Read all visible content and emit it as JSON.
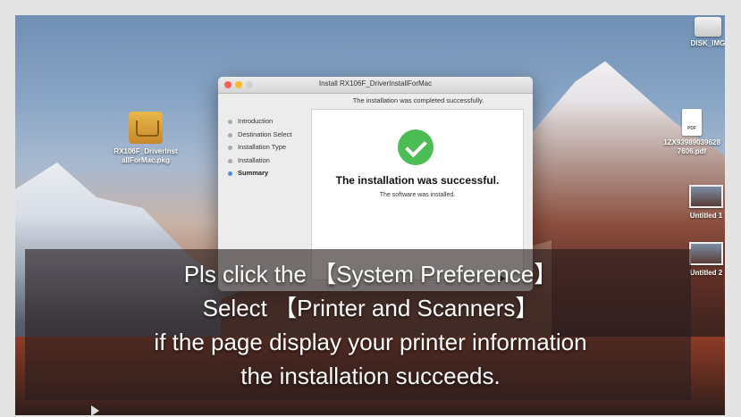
{
  "desktop": {
    "icons": [
      {
        "label": "DISK_IMG"
      },
      {
        "label": "RX106F_DriverInst allForMac.pkg"
      },
      {
        "label": "1ZX93989039628 7606.pdf",
        "badge": "PDF"
      },
      {
        "label": "Untitled 1"
      },
      {
        "label": "Untitled 2"
      }
    ]
  },
  "installer": {
    "window_title": "Install RX106F_DriverInstallForMac",
    "subheader": "The installation was completed successfully.",
    "steps": [
      "Introduction",
      "Destination Select",
      "Installation Type",
      "Installation",
      "Summary"
    ],
    "active_step": "Summary",
    "success_title": "The installation was successful.",
    "success_subtitle": "The software was installed."
  },
  "caption": {
    "lines": [
      "Pls click the 【System Preference】",
      "Select 【Printer and Scanners】",
      "if the page display your printer information",
      "the installation succeeds."
    ]
  },
  "colors": {
    "check_green": "#4bbd52",
    "active_step_dot": "#4a90e2"
  }
}
